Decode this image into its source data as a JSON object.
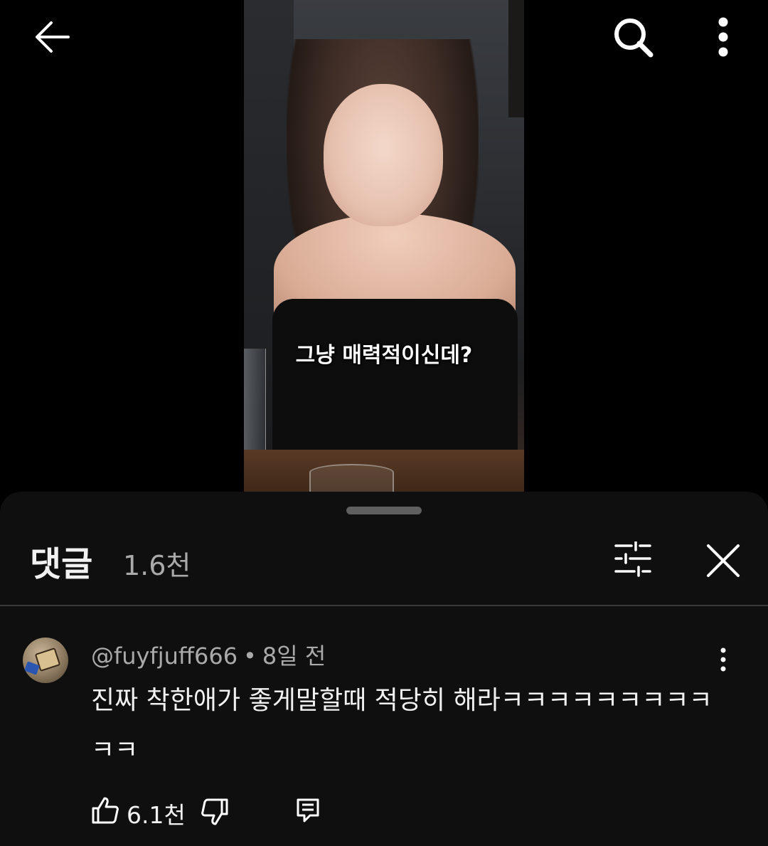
{
  "video": {
    "subtitle": "그냥 매력적이신데?"
  },
  "top_bar": {
    "back_icon": "arrow-left-icon",
    "search_icon": "search-icon",
    "more_icon": "more-vertical-icon"
  },
  "comments": {
    "title": "댓글",
    "count": "1.6천",
    "filter_icon": "sliders-icon",
    "close_icon": "close-icon",
    "items": [
      {
        "author": "@fuyfjuff666",
        "separator": "•",
        "time": "8일 전",
        "text": "진짜 착한애가 좋게말할때 적당히 해라ㅋㅋㅋㅋㅋㅋㅋㅋㅋㅋㅋ",
        "likes": "6.1천"
      }
    ]
  },
  "colors": {
    "background": "#000000",
    "sheet": "#0f0f0f",
    "primary_text": "#f1f1f1",
    "secondary_text": "#aaaaaa"
  }
}
